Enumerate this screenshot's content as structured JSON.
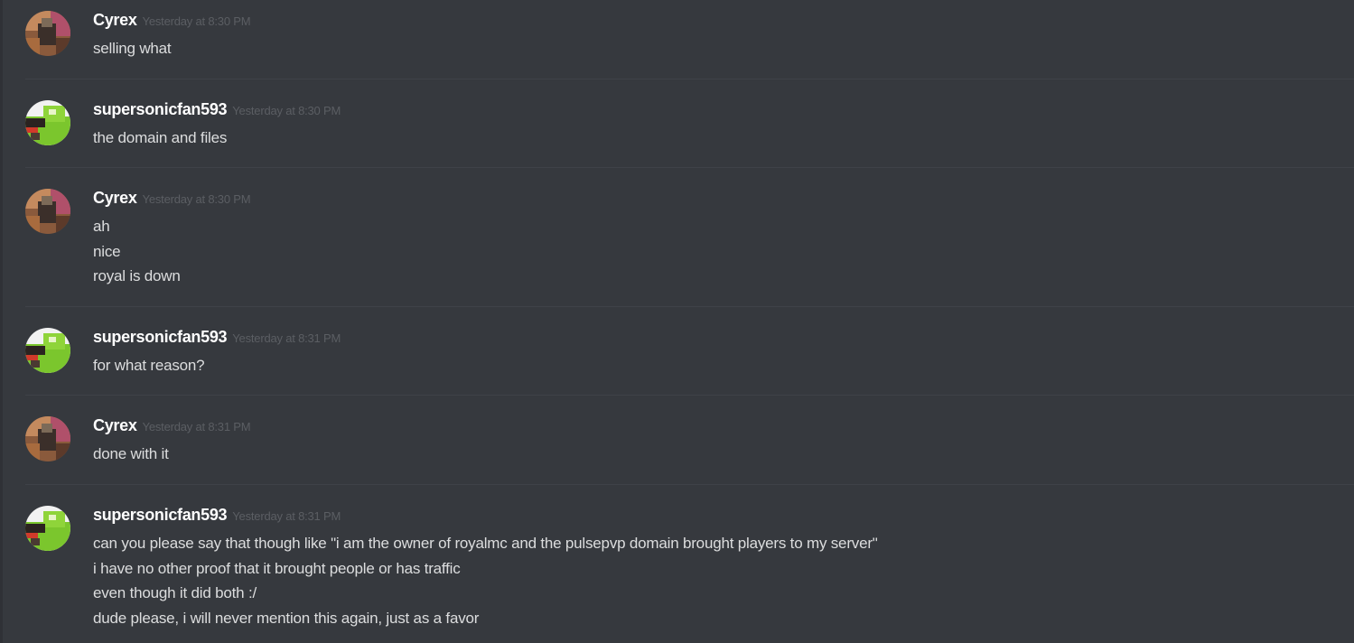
{
  "colors": {
    "background": "#36393e",
    "username": "#ffffff",
    "timestamp": "#5b5e63",
    "message_text": "#dcddde",
    "divider": "#3f4248"
  },
  "messages": [
    {
      "author": "Cyrex",
      "avatar_icon": "cyrex-avatar",
      "timestamp": "Yesterday at 8:30 PM",
      "lines": [
        "selling what"
      ]
    },
    {
      "author": "supersonicfan593",
      "avatar_icon": "supersonicfan-avatar",
      "timestamp": "Yesterday at 8:30 PM",
      "lines": [
        "the domain and files"
      ]
    },
    {
      "author": "Cyrex",
      "avatar_icon": "cyrex-avatar",
      "timestamp": "Yesterday at 8:30 PM",
      "lines": [
        "ah",
        "nice",
        "royal is down"
      ]
    },
    {
      "author": "supersonicfan593",
      "avatar_icon": "supersonicfan-avatar",
      "timestamp": "Yesterday at 8:31 PM",
      "lines": [
        "for what reason?"
      ]
    },
    {
      "author": "Cyrex",
      "avatar_icon": "cyrex-avatar",
      "timestamp": "Yesterday at 8:31 PM",
      "lines": [
        "done with it"
      ]
    },
    {
      "author": "supersonicfan593",
      "avatar_icon": "supersonicfan-avatar",
      "timestamp": "Yesterday at 8:31 PM",
      "lines": [
        "can you please say that though like \"i am the owner of royalmc and the pulsepvp domain brought players to my server\"",
        "i have no other proof that it brought people or has traffic",
        "even though it did both :/",
        "dude please, i will never mention this again, just as a favor"
      ]
    }
  ]
}
